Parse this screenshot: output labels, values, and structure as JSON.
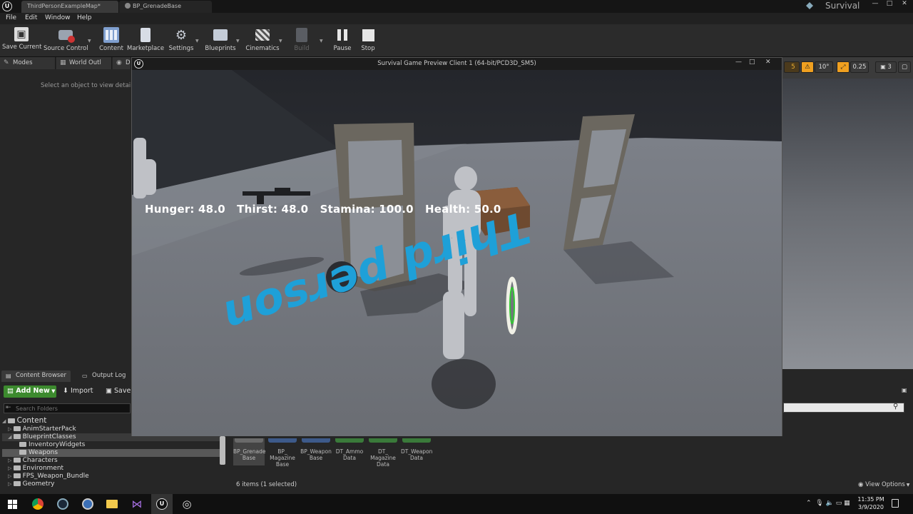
{
  "window": {
    "tabs": [
      {
        "label": "ThirdPersonExampleMap*"
      },
      {
        "label": "BP_GrenadeBase"
      }
    ],
    "project_name": "Survival",
    "controls": {
      "minimize": "—",
      "maximize": "□",
      "close": "✕"
    }
  },
  "menu": {
    "items": [
      "File",
      "Edit",
      "Window",
      "Help"
    ]
  },
  "toolbar": {
    "buttons": [
      {
        "label": "Save Current",
        "icon": "save-icon"
      },
      {
        "label": "Source Control",
        "icon": "source-control-icon"
      },
      {
        "label": "Content",
        "icon": "content-icon"
      },
      {
        "label": "Marketplace",
        "icon": "marketplace-icon"
      },
      {
        "label": "Settings",
        "icon": "settings-icon"
      },
      {
        "label": "Blueprints",
        "icon": "blueprints-icon"
      },
      {
        "label": "Cinematics",
        "icon": "cinematics-icon"
      },
      {
        "label": "Build",
        "icon": "build-icon"
      },
      {
        "label": "Pause",
        "icon": "pause-icon"
      },
      {
        "label": "Stop",
        "icon": "stop-icon"
      }
    ]
  },
  "left_panel": {
    "tabs": [
      "Modes",
      "World Outl",
      "D"
    ],
    "details_hint": "Select an object to view details."
  },
  "viewport_tools": {
    "grid": "5",
    "rotation": "10°",
    "scale": "0.25",
    "camera": "3"
  },
  "preview_window": {
    "title": "Survival Game Preview Client 1 (64-bit/PCD3D_SM5)",
    "hud": {
      "hunger": "Hunger: 48.0",
      "thirst": "Thirst: 48.0",
      "stamina": "Stamina: 100.0",
      "health": "Health: 50.0"
    },
    "floor_text": "Third person"
  },
  "content_browser": {
    "tabs": [
      "Content Browser",
      "Output Log"
    ],
    "add_new": "Add New",
    "import": "Import",
    "save": "Save",
    "search_placeholder": "Search Folders",
    "root": "Content",
    "folders": [
      {
        "label": "AnimStarterPack"
      },
      {
        "label": "BlueprintClasses"
      },
      {
        "label": "InventoryWidgets"
      },
      {
        "label": "Weapons"
      },
      {
        "label": "Characters"
      },
      {
        "label": "Environment"
      },
      {
        "label": "FPS_Weapon_Bundle"
      },
      {
        "label": "Geometry"
      }
    ],
    "assets": [
      {
        "label": "BP_Grenade Base"
      },
      {
        "label": "BP_ Magazine Base"
      },
      {
        "label": "BP_Weapon Base"
      },
      {
        "label": "DT_Ammo Data"
      },
      {
        "label": "DT_ Magazine Data"
      },
      {
        "label": "DT_Weapon Data"
      }
    ],
    "status": "6 items (1 selected)",
    "view_options": "View Options"
  },
  "taskbar": {
    "time": "11:35 PM",
    "date": "3/9/2020"
  },
  "colors": {
    "add_new": "#3c8a2e",
    "floor_text": "#1ea0d8",
    "hud_text": "#ffffff"
  }
}
